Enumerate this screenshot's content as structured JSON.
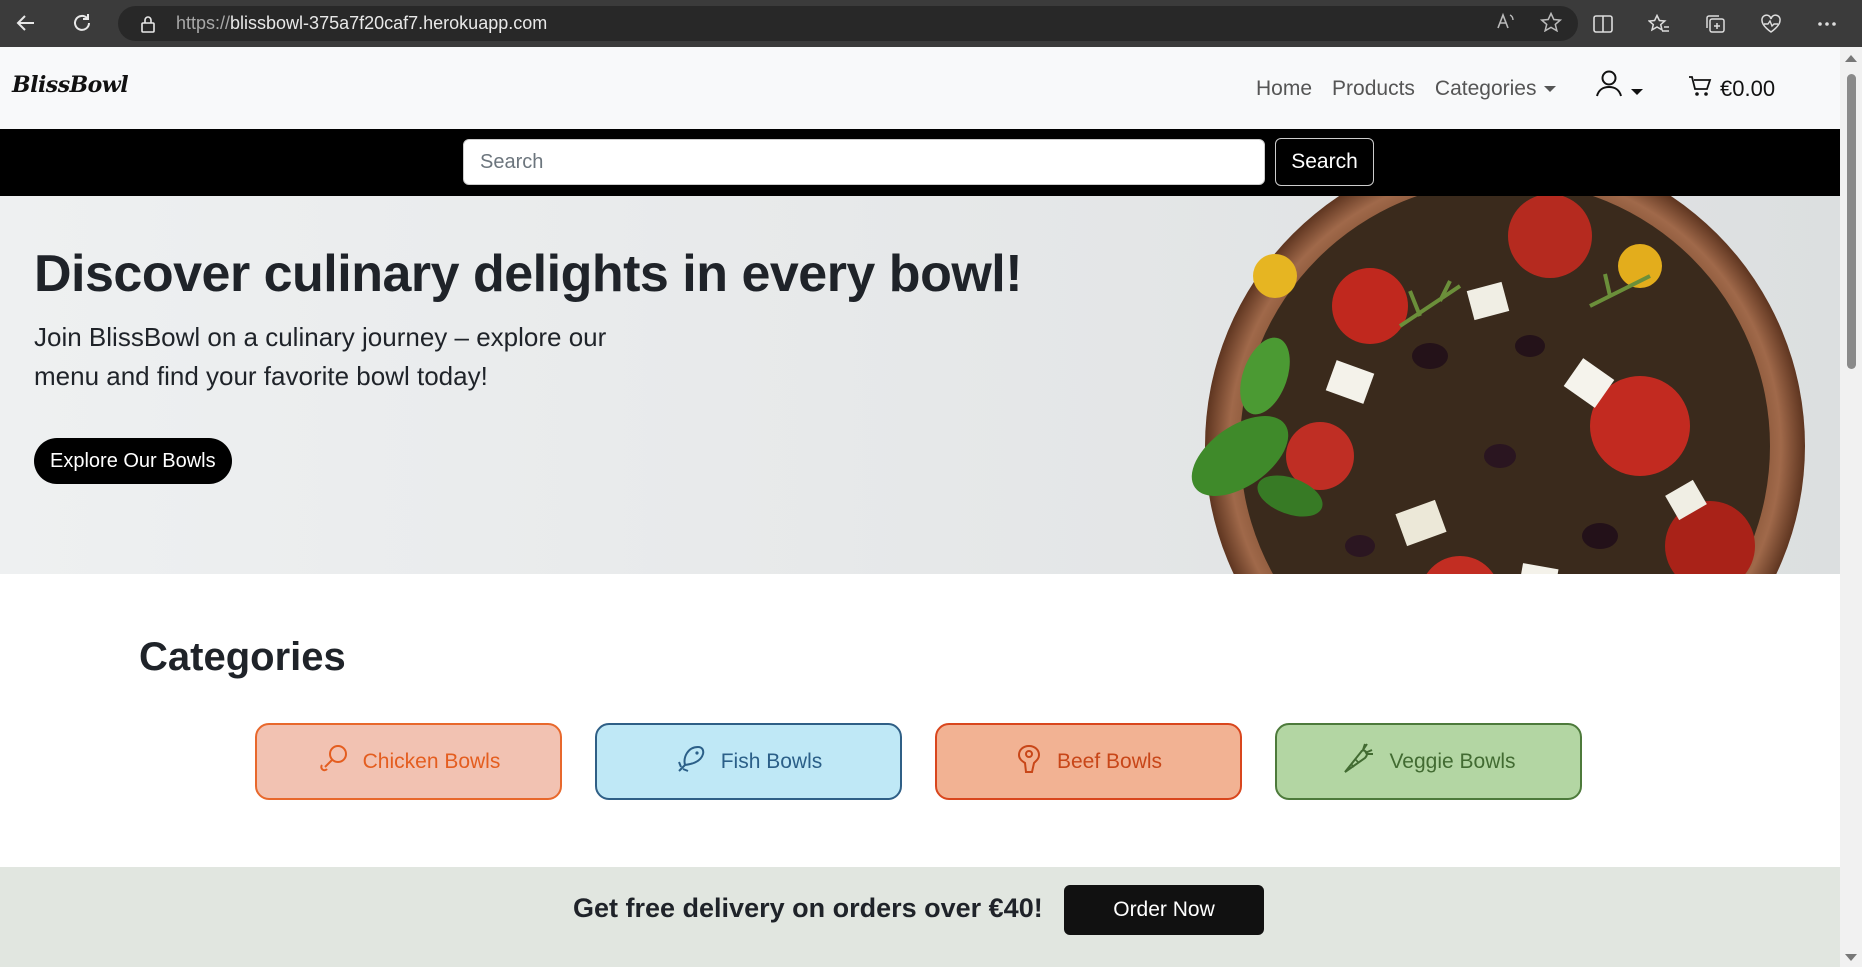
{
  "browser": {
    "url_proto": "https://",
    "url_host": "blissbowl-375a7f20caf7.herokuapp.com"
  },
  "navbar": {
    "brand": "BlissBowl",
    "links": [
      "Home",
      "Products",
      "Categories"
    ],
    "cart_total": "€0.00"
  },
  "search": {
    "placeholder": "Search",
    "button_label": "Search"
  },
  "hero": {
    "title": "Discover culinary delights in every bowl!",
    "subtitle": "Join BlissBowl on a culinary journey – explore our menu and find your favorite bowl today!",
    "button_label": "Explore Our Bowls"
  },
  "categories": {
    "title": "Categories",
    "items": [
      {
        "label": "Chicken Bowls",
        "icon": "drumstick-icon"
      },
      {
        "label": "Fish Bowls",
        "icon": "fish-icon"
      },
      {
        "label": "Beef Bowls",
        "icon": "steak-icon"
      },
      {
        "label": "Veggie Bowls",
        "icon": "carrot-icon"
      }
    ]
  },
  "promo": {
    "text": "Get free delivery on orders over €40!",
    "button_label": "Order Now"
  },
  "colors": {
    "chicken": "#e45d1f",
    "fish": "#2b5f88",
    "beef": "#c84618",
    "veggie": "#426b32"
  }
}
